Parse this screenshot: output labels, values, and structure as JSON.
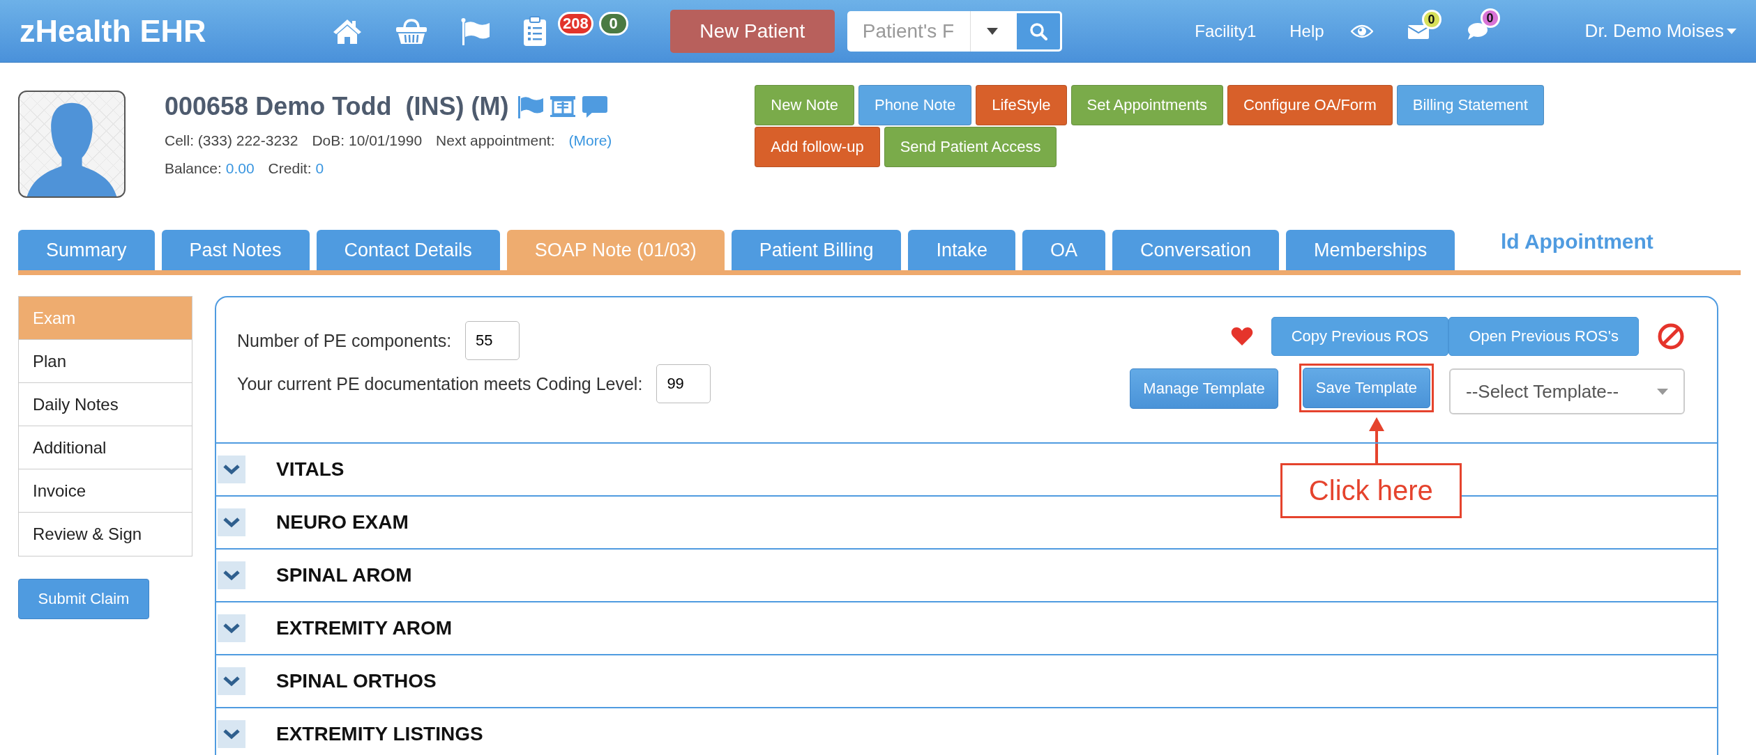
{
  "app": {
    "title": "zHealth EHR"
  },
  "counters": [
    {
      "count": "208",
      "color": "#e2342b"
    },
    {
      "count": "0",
      "color": "#4b7a43"
    }
  ],
  "new_patient_button": "New Patient",
  "search": {
    "placeholder": "Patient's F"
  },
  "top_links": [
    "Facility1",
    "Help"
  ],
  "notifications": [
    {
      "kind": "mail",
      "count": "0",
      "color": "#d7e05a"
    },
    {
      "kind": "chat",
      "count": "0",
      "color": "#d873d6"
    }
  ],
  "user": "Dr. Demo Moises",
  "patient": {
    "name": "000658 Demo Todd  (INS) (M)",
    "cell": "Cell: (333) 222-3232",
    "dob": "DoB: 10/01/1990",
    "next_appointment_label": "Next appointment:",
    "next_appointment_link": "(More)",
    "balance_label": "Balance:",
    "balance": "0.00",
    "credit_label": "Credit:",
    "credit": "0"
  },
  "actions": [
    {
      "label": "New Note",
      "color": "#7aab4a"
    },
    {
      "label": "Phone Note",
      "color": "#5aa5e2"
    },
    {
      "label": "LifeStyle",
      "color": "#d8602a"
    },
    {
      "label": "Set Appointments",
      "color": "#7aab4a"
    },
    {
      "label": "Configure OA/Form",
      "color": "#d8602a"
    },
    {
      "label": "Billing Statement",
      "color": "#5aa5e2"
    },
    {
      "label": "Add follow-up",
      "color": "#d8602a"
    },
    {
      "label": "Send Patient Access",
      "color": "#7aab4a"
    }
  ],
  "tabs": [
    {
      "label": "Summary",
      "selected": false
    },
    {
      "label": "Past Notes",
      "selected": false
    },
    {
      "label": "Contact Details",
      "selected": false
    },
    {
      "label": "SOAP Note (01/03)",
      "selected": true
    },
    {
      "label": "Patient Billing",
      "selected": false
    },
    {
      "label": "Intake",
      "selected": false
    },
    {
      "label": "OA",
      "selected": false
    },
    {
      "label": "Conversation",
      "selected": false
    },
    {
      "label": "Memberships",
      "selected": false
    }
  ],
  "tab_overflow_text": "ld Appointment",
  "sidebar": {
    "items": [
      {
        "label": "Exam",
        "selected": true
      },
      {
        "label": "Plan",
        "selected": false
      },
      {
        "label": "Daily Notes",
        "selected": false
      },
      {
        "label": "Additional",
        "selected": false
      },
      {
        "label": "Invoice",
        "selected": false
      },
      {
        "label": "Review & Sign",
        "selected": false
      }
    ],
    "submit_button": "Submit Claim"
  },
  "exam": {
    "pe_components_label": "Number of PE components:",
    "pe_components": "55",
    "coding_level_label": "Your current PE documentation meets Coding Level:",
    "coding_level": "99",
    "ros_buttons": [
      "Copy Previous ROS",
      "Open Previous ROS's"
    ],
    "manage_template_button": "Manage Template",
    "save_template_button": "Save Template",
    "template_select": "--Select Template--",
    "callout": "Click here",
    "sections": [
      "VITALS",
      "NEURO EXAM",
      "SPINAL AROM",
      "EXTREMITY AROM",
      "SPINAL ORTHOS",
      "EXTREMITY LISTINGS"
    ]
  }
}
